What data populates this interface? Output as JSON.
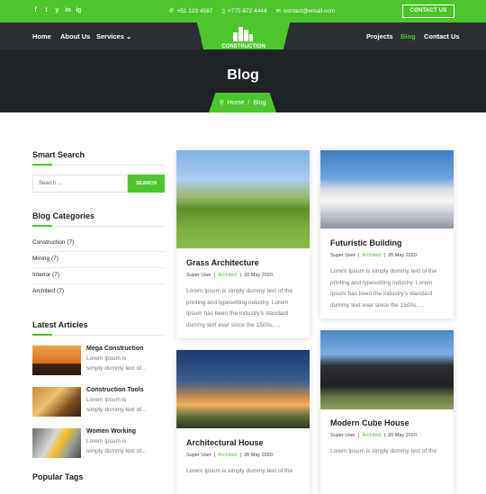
{
  "topbar": {
    "social": [
      "f",
      "t",
      "y",
      "in",
      "ig"
    ],
    "phone1": "+51 123 4567",
    "phone2": "+775 872 4444",
    "email": "contact@email.com",
    "contact_button": "CONTACT US"
  },
  "nav": {
    "home": "Home",
    "about": "About Us",
    "services": "Services",
    "projects": "Projects",
    "blog": "Blog",
    "contact": "Contact Us",
    "logo_text": "CONSTRUCTION"
  },
  "hero": {
    "title": "Blog",
    "crumb_home": "Home",
    "crumb_sep": "/",
    "crumb_current": "Blog"
  },
  "sidebar": {
    "search_title": "Smart Search",
    "search_placeholder": "Search ...",
    "search_button": "SEARCH",
    "categories_title": "Blog Categories",
    "categories": [
      "Construction (7)",
      "Mining (7)",
      "Interior (7)",
      "Architect (7)"
    ],
    "articles_title": "Latest Articles",
    "articles": [
      {
        "title": "Mega Construction",
        "line1": "Lorem Ipsum is",
        "line2": "simply dummy text of..."
      },
      {
        "title": "Construction Tools",
        "line1": "Lorem Ipsum is",
        "line2": "simply dummy text of..."
      },
      {
        "title": "Women Working",
        "line1": "Lorem Ipsum is",
        "line2": "simply dummy text of..."
      }
    ],
    "tags_title": "Popular Tags"
  },
  "posts": [
    {
      "title": "Grass Architecture",
      "author": "Super User",
      "category": "Architect",
      "date": "20 May 2020",
      "l1": "Lorem Ipsum is simply dummy text of the",
      "l2": "printing and typesetting industry. Lorem",
      "l3": "Ipsum has been the industry's standard",
      "l4": "dummy text ever since the 1500s, ..."
    },
    {
      "title": "Futuristic Building",
      "author": "Super User",
      "category": "Architect",
      "date": "20 May 2020",
      "l1": "Lorem Ipsum is simply dummy text of the",
      "l2": "printing and typesetting industry. Lorem",
      "l3": "Ipsum has been the industry's standard",
      "l4": "dummy text ever since the 1500s, ..."
    },
    {
      "title": "Architectural House",
      "author": "Super User",
      "category": "Architect",
      "date": "20 May 2020",
      "l1": "Lorem Ipsum is simply dummy text of the"
    },
    {
      "title": "Modern Cube House",
      "author": "Super User",
      "category": "Architect",
      "date": "20 May 2020",
      "l1": "Lorem Ipsum is simply dummy text of the"
    }
  ],
  "colors": {
    "accent": "#4cc62b",
    "nav_bg": "#2b2f33",
    "hero_bg": "#1f2226"
  }
}
